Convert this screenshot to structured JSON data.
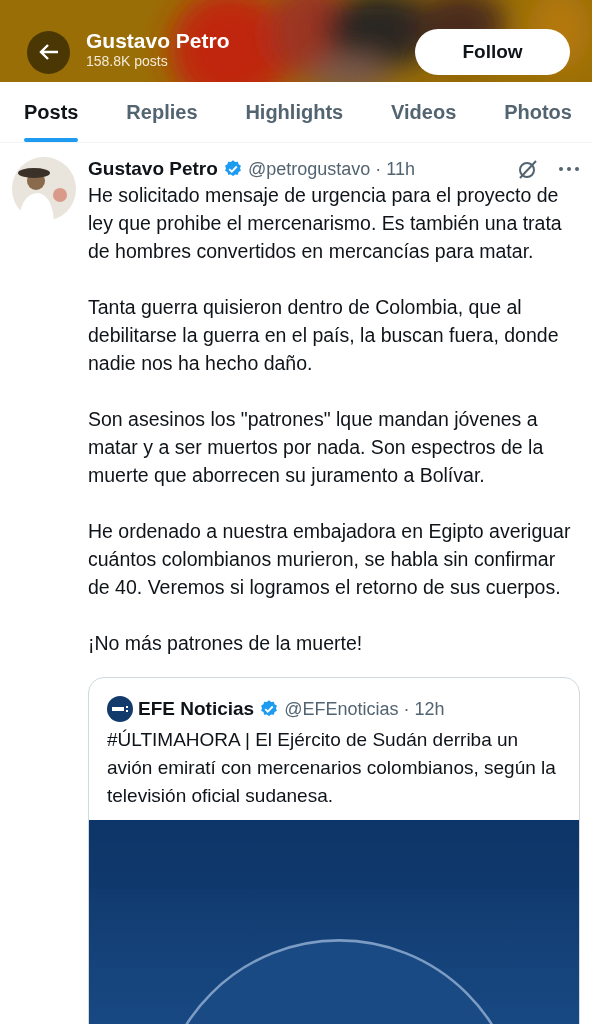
{
  "header": {
    "name": "Gustavo Petro",
    "post_count": "158.8K posts",
    "follow_button": "Follow"
  },
  "tabs": [
    {
      "label": "Posts",
      "selected": true
    },
    {
      "label": "Replies",
      "selected": false
    },
    {
      "label": "Highlights",
      "selected": false
    },
    {
      "label": "Videos",
      "selected": false
    },
    {
      "label": "Photos",
      "selected": false
    }
  ],
  "post": {
    "author": "Gustavo Petro",
    "verified": true,
    "handle": "@petrogustavo",
    "separator": "·",
    "time": "11h",
    "paragraphs": [
      "He solicitado mensaje de urgencia para el proyecto de ley que prohibe el mercenarismo. Es también una trata de hombres convertidos en mercancías para matar.",
      "Tanta guerra quisieron dentro de Colombia, que al debilitarse la guerra en el país, la buscan fuera, donde nadie nos ha hecho daño.",
      "Son asesinos los \"patrones\" lque mandan jóvenes a matar y a ser muertos por nada. Son espectros de la muerte que aborrecen su juramento a Bolívar.",
      "He ordenado a nuestra embajadora en Egipto averiguar cuántos colombianos murieron, se habla sin confirmar de 40. Veremos si logramos el retorno de sus cuerpos.",
      "¡No más patrones de la muerte!"
    ],
    "quote": {
      "author": "EFE Noticias",
      "verified": true,
      "handle": "@EFEnoticias",
      "separator": "·",
      "time": "12h",
      "text": "#ÚLTIMAHORA | El Ejército de Sudán derriba un avión emiratí con mercenarios colombianos, según la televisión oficial sudanesa."
    }
  }
}
